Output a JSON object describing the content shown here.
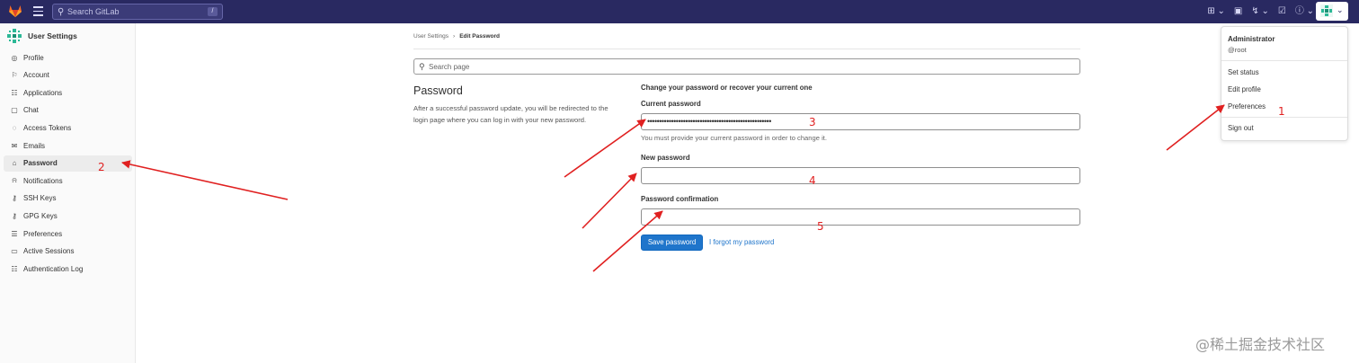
{
  "topbar": {
    "search_placeholder": "Search GitLab",
    "search_shortcut": "/",
    "icons": [
      "plus-icon",
      "issues-icon",
      "merge-request-icon",
      "todo-icon",
      "help-icon"
    ],
    "colors": {
      "navbar": "#292961",
      "accent": "#1f75cb"
    }
  },
  "sidebar": {
    "title": "User Settings",
    "items": [
      {
        "label": "Profile",
        "icon": "profile-icon",
        "glyph": "◎"
      },
      {
        "label": "Account",
        "icon": "account-icon",
        "glyph": "⚐"
      },
      {
        "label": "Applications",
        "icon": "applications-icon",
        "glyph": "☷"
      },
      {
        "label": "Chat",
        "icon": "chat-icon",
        "glyph": "▢"
      },
      {
        "label": "Access Tokens",
        "icon": "token-icon",
        "glyph": "◌"
      },
      {
        "label": "Emails",
        "icon": "email-icon",
        "glyph": "✉"
      },
      {
        "label": "Password",
        "icon": "lock-icon",
        "glyph": "⌂",
        "active": true
      },
      {
        "label": "Notifications",
        "icon": "bell-icon",
        "glyph": "⍾"
      },
      {
        "label": "SSH Keys",
        "icon": "key-icon",
        "glyph": "⚷"
      },
      {
        "label": "GPG Keys",
        "icon": "key-icon",
        "glyph": "⚷"
      },
      {
        "label": "Preferences",
        "icon": "preferences-icon",
        "glyph": "☰"
      },
      {
        "label": "Active Sessions",
        "icon": "monitor-icon",
        "glyph": "▭"
      },
      {
        "label": "Authentication Log",
        "icon": "log-icon",
        "glyph": "☷"
      }
    ]
  },
  "breadcrumb": {
    "parent": "User Settings",
    "sep": "›",
    "current": "Edit Password"
  },
  "page_search": {
    "placeholder": "Search page"
  },
  "section": {
    "title": "Password",
    "description": "After a successful password update, you will be redirected to the login page where you can log in with your new password."
  },
  "form": {
    "intro": "Change your password or recover your current one",
    "current_label": "Current password",
    "current_value": "••••••••••••••••••••••••••••••••••••••••••••••••••••",
    "current_help": "You must provide your current password in order to change it.",
    "new_label": "New password",
    "new_value": "",
    "confirm_label": "Password confirmation",
    "confirm_value": "",
    "save_label": "Save password",
    "forgot_label": "I forgot my password"
  },
  "dropdown": {
    "name": "Administrator",
    "username": "@root",
    "items": [
      "Set status",
      "Edit profile",
      "Preferences",
      "Sign out"
    ]
  },
  "annotations": {
    "n1": "1",
    "n2": "2",
    "n3": "3",
    "n4": "4",
    "n5": "5",
    "color": "#e02020"
  },
  "watermark": "@稀土掘金技术社区"
}
